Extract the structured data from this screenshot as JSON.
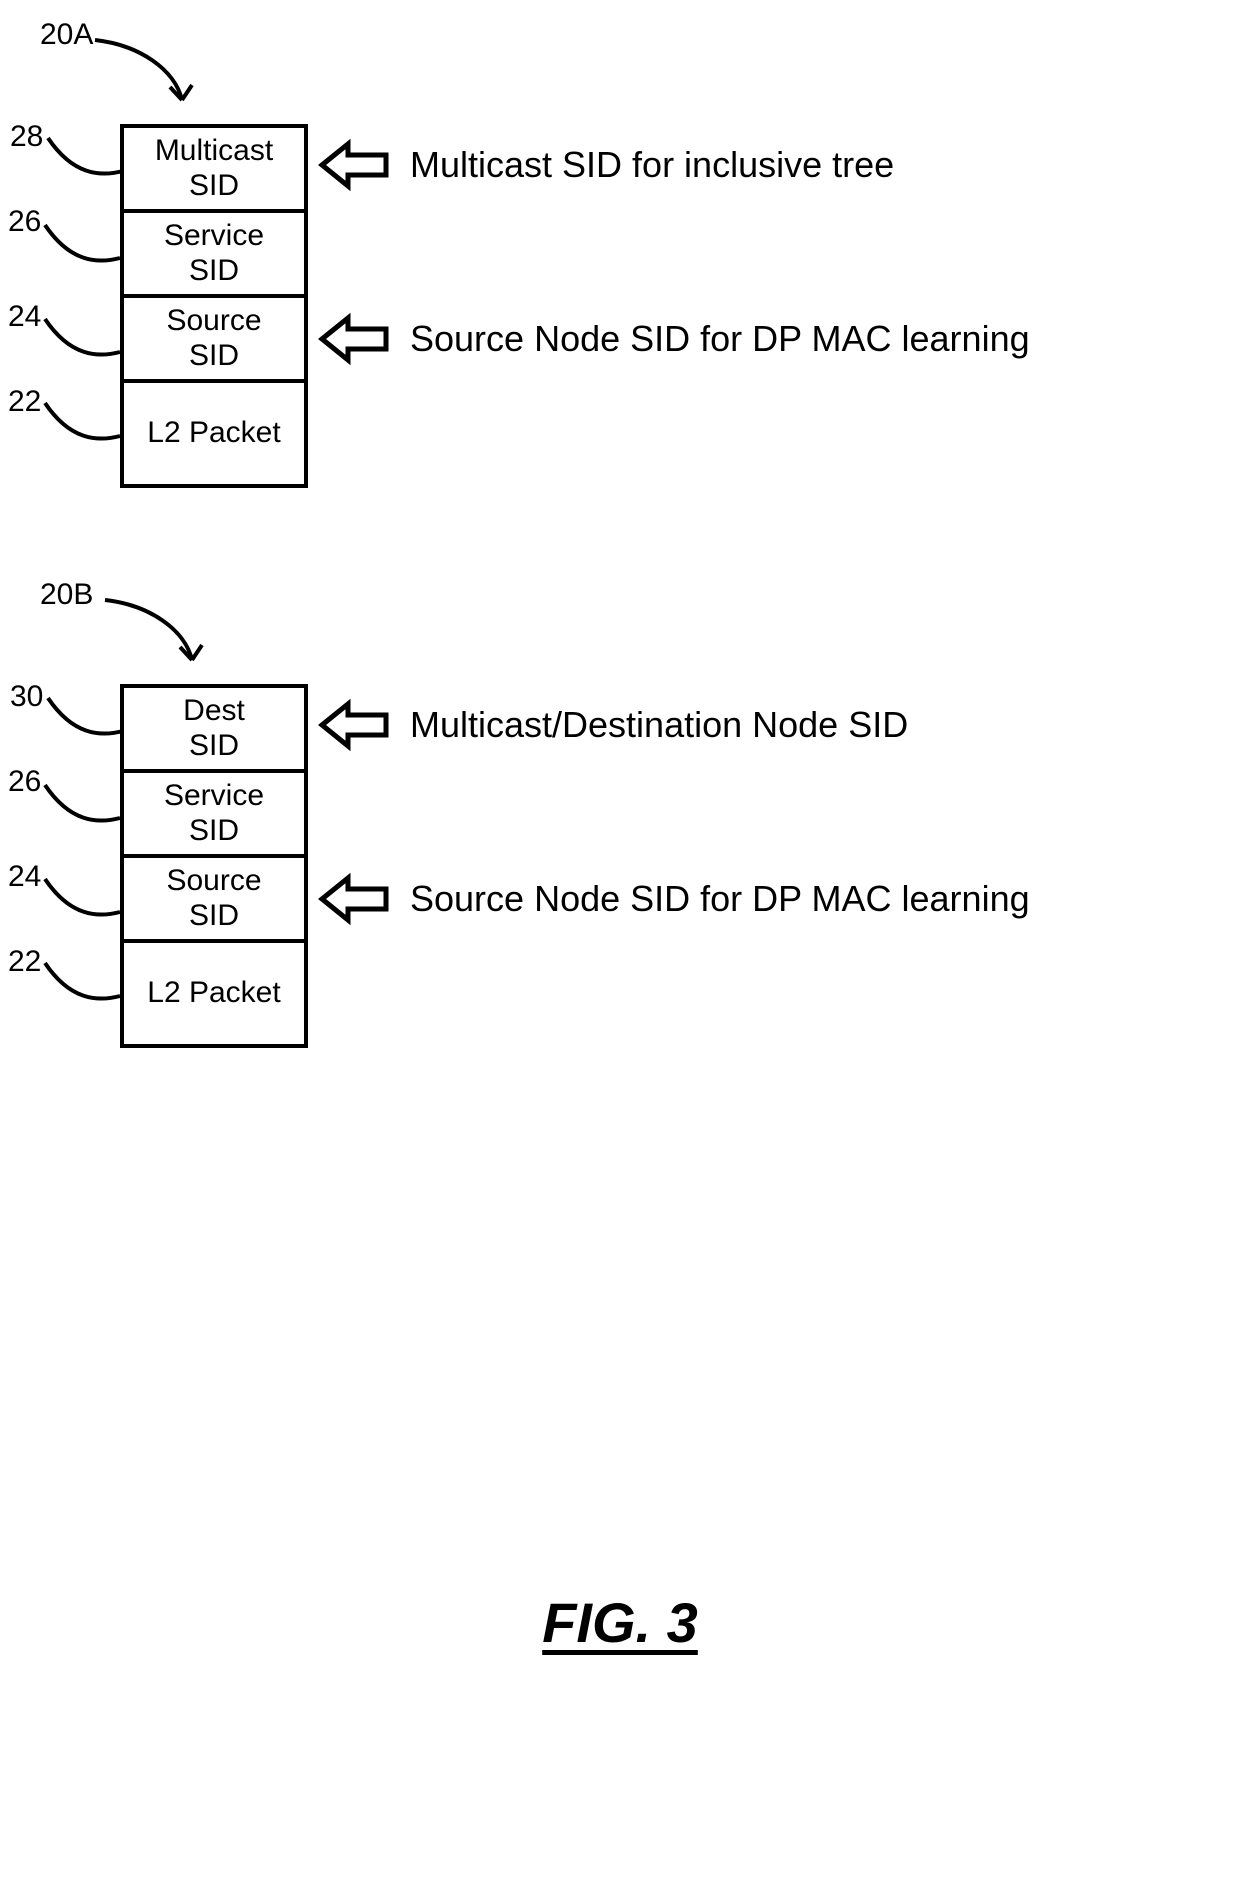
{
  "groupA": {
    "ref": "20A",
    "labels": {
      "l28": "28",
      "l26": "26",
      "l24": "24",
      "l22": "22"
    },
    "cells": {
      "multicast_line1": "Multicast",
      "multicast_line2": "SID",
      "service_line1": "Service",
      "service_line2": "SID",
      "source_line1": "Source",
      "source_line2": "SID",
      "l2": "L2 Packet"
    },
    "annotations": {
      "top": "Multicast SID for inclusive tree",
      "src": "Source Node SID for DP MAC learning"
    }
  },
  "groupB": {
    "ref": "20B",
    "labels": {
      "l30": "30",
      "l26": "26",
      "l24": "24",
      "l22": "22"
    },
    "cells": {
      "dest_line1": "Dest",
      "dest_line2": "SID",
      "service_line1": "Service",
      "service_line2": "SID",
      "source_line1": "Source",
      "source_line2": "SID",
      "l2": "L2 Packet"
    },
    "annotations": {
      "top": "Multicast/Destination Node SID",
      "src": "Source Node SID for DP MAC learning"
    }
  },
  "figure": "FIG. 3"
}
